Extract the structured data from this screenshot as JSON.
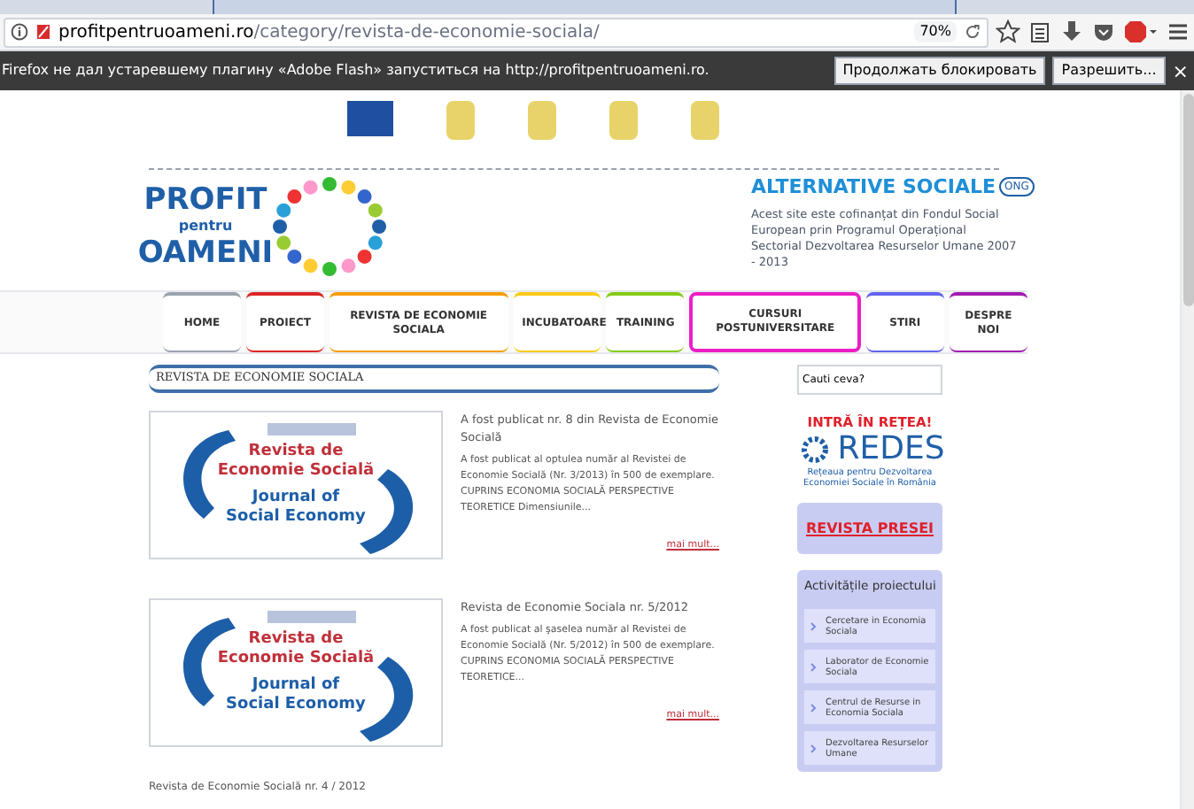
{
  "browser": {
    "url_host": "profitpentruoameni.ro",
    "url_path": "/category/revista-de-economie-sociala/",
    "zoom": "70%"
  },
  "notification": {
    "message": "Firefox не дал устаревшему плагину «Adobe Flash» запуститься на http://profitpentruoameni.ro.",
    "buttons": [
      "Продолжать блокировать",
      "Разрешить..."
    ],
    "close": "×"
  },
  "logo": {
    "line1": "PROFIT",
    "line2": "pentru",
    "line3": "OAMENI"
  },
  "partner": {
    "name": "ALTERNATIVE SOCIALE",
    "badge": "ONG",
    "note": "Acest site este cofinanțat din Fondul Social European prin Programul Operațional Sectorial Dezvoltarea Resurselor Umane 2007 - 2013"
  },
  "nav": [
    {
      "label": "HOME",
      "color": "#9ca3af",
      "selected": false
    },
    {
      "label": "PROIECT",
      "color": "#dc2626",
      "selected": false
    },
    {
      "label": "REVISTA DE ECONOMIE SOCIALA",
      "color": "#f59e0b",
      "selected": false
    },
    {
      "label": "INCUBATOARE",
      "color": "#facc15",
      "selected": false
    },
    {
      "label": "TRAINING",
      "color": "#84cc16",
      "selected": false
    },
    {
      "label": "CURSURI POSTUNIVERSITARE",
      "color": "#ec1ec6",
      "selected": true
    },
    {
      "label": "STIRI",
      "color": "#6366f1",
      "selected": false
    },
    {
      "label": "DESPRE NOI",
      "color": "#a21caf",
      "selected": false
    }
  ],
  "section_title": "REVISTA DE ECONOMIE SOCIALA",
  "posts": [
    {
      "cover": [
        "Revista de",
        "Economie Socială",
        "Journal of",
        "Social Economy"
      ],
      "title": "A fost publicat nr. 8 din Revista de Economie Socială",
      "excerpt": "A fost publicat al optulea număr al Revistei de Economie Socială (Nr. 3/2013) în 500 de exemplare. CUPRINS ECONOMIA SOCIALĂ PERSPECTIVE TEORETICE Dimensiunile...",
      "more": "mai mult..."
    },
    {
      "cover": [
        "Revista de",
        "Economie Socială",
        "Journal of",
        "Social Economy"
      ],
      "title": "Revista de Economie Sociala nr. 5/2012",
      "excerpt": "A fost publicat al şaselea număr al Revistei de Economie Socială (Nr. 5/2012) în 500 de exemplare. CUPRINS ECONOMIA SOCIALĂ PERSPECTIVE TEORETICE...",
      "more": "mai mult..."
    }
  ],
  "next_post_title": "Revista de Economie Socială nr. 4 / 2012",
  "sidebar": {
    "search_placeholder": "Cauti ceva?",
    "network_heading": "INTRĂ ÎN REȚEA!",
    "redes": "REDES",
    "redes_caption": "Rețeaua pentru Dezvoltarea Economiei Sociale în România",
    "press_link": "REVISTA PRESEI",
    "activities_title": "Activitățile proiectului",
    "activities": [
      "Cercetare in Economia Sociala",
      "Laborator de Economie Sociala",
      "Centrul de Resurse in Economia Sociala",
      "Dezvoltarea Resurselor Umane"
    ]
  }
}
